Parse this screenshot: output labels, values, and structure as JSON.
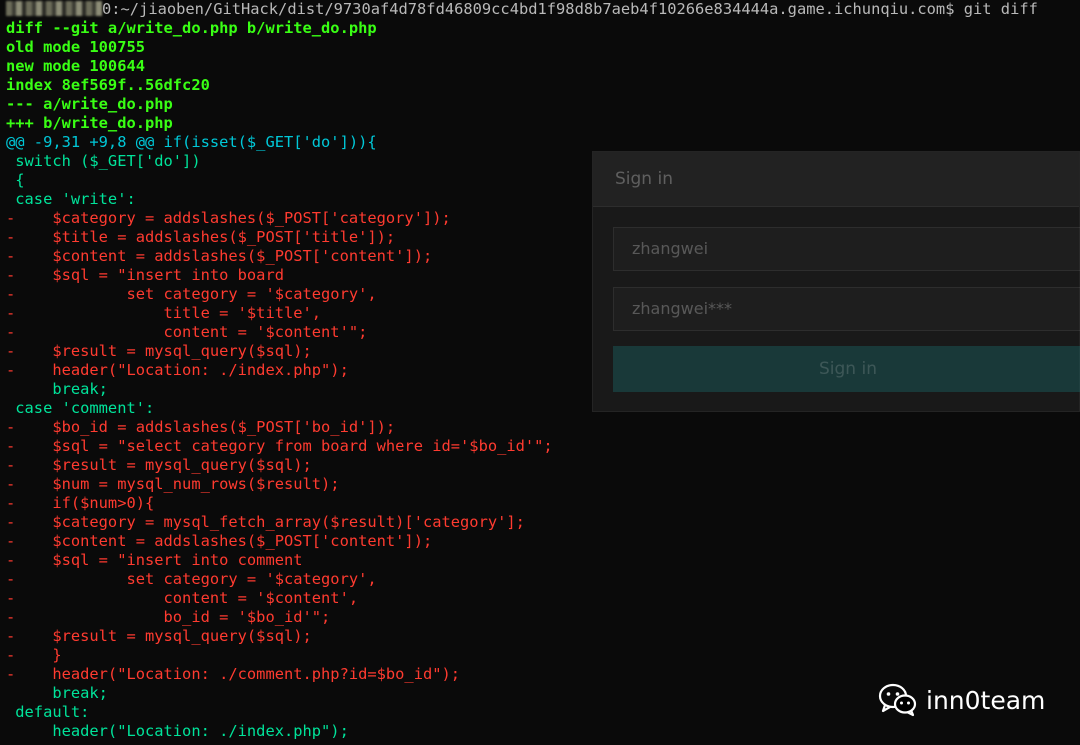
{
  "terminal": {
    "prompt_user": "0:~/jiaoben/GitHack/dist/9730af4d78fd46809cc4bd1f98d8b7aeb4f10266e834444a.game.ichunqiu.com$ git diff",
    "lines": [
      {
        "type": "meta",
        "text": "diff --git a/write_do.php b/write_do.php"
      },
      {
        "type": "meta",
        "text": "old mode 100755"
      },
      {
        "type": "meta",
        "text": "new mode 100644"
      },
      {
        "type": "meta",
        "text": "index 8ef569f..56dfc20"
      },
      {
        "type": "meta",
        "text": "--- a/write_do.php"
      },
      {
        "type": "meta",
        "text": "+++ b/write_do.php"
      },
      {
        "type": "hunk",
        "text": "@@ -9,31 +9,8 @@ if(isset($_GET['do'])){"
      },
      {
        "type": "ctx",
        "text": " switch ($_GET['do'])"
      },
      {
        "type": "ctx",
        "text": " {"
      },
      {
        "type": "ctx",
        "text": " case 'write':"
      },
      {
        "type": "del",
        "text": "-    $category = addslashes($_POST['category']);"
      },
      {
        "type": "del",
        "text": "-    $title = addslashes($_POST['title']);"
      },
      {
        "type": "del",
        "text": "-    $content = addslashes($_POST['content']);"
      },
      {
        "type": "del",
        "text": "-    $sql = \"insert into board"
      },
      {
        "type": "del",
        "text": "-            set category = '$category',"
      },
      {
        "type": "del",
        "text": "-                title = '$title',"
      },
      {
        "type": "del",
        "text": "-                content = '$content'\";"
      },
      {
        "type": "del",
        "text": "-    $result = mysql_query($sql);"
      },
      {
        "type": "del",
        "text": "-    header(\"Location: ./index.php\");"
      },
      {
        "type": "ctx",
        "text": "     break;"
      },
      {
        "type": "ctx",
        "text": " case 'comment':"
      },
      {
        "type": "del",
        "text": "-    $bo_id = addslashes($_POST['bo_id']);"
      },
      {
        "type": "del",
        "text": "-    $sql = \"select category from board where id='$bo_id'\";"
      },
      {
        "type": "del",
        "text": "-    $result = mysql_query($sql);"
      },
      {
        "type": "del",
        "text": "-    $num = mysql_num_rows($result);"
      },
      {
        "type": "del",
        "text": "-    if($num>0){"
      },
      {
        "type": "del",
        "text": "-    $category = mysql_fetch_array($result)['category'];"
      },
      {
        "type": "del",
        "text": "-    $content = addslashes($_POST['content']);"
      },
      {
        "type": "del",
        "text": "-    $sql = \"insert into comment"
      },
      {
        "type": "del",
        "text": "-            set category = '$category',"
      },
      {
        "type": "del",
        "text": "-                content = '$content',"
      },
      {
        "type": "del",
        "text": "-                bo_id = '$bo_id'\";"
      },
      {
        "type": "del",
        "text": "-    $result = mysql_query($sql);"
      },
      {
        "type": "del",
        "text": "-    }"
      },
      {
        "type": "del",
        "text": "-    header(\"Location: ./comment.php?id=$bo_id\");"
      },
      {
        "type": "ctx",
        "text": "     break;"
      },
      {
        "type": "ctx",
        "text": " default:"
      },
      {
        "type": "ctx",
        "text": "     header(\"Location: ./index.php\");"
      }
    ]
  },
  "signin_overlay": {
    "title": "Sign in",
    "username_value": "zhangwei",
    "password_value": "zhangwei***",
    "button_label": "Sign in"
  },
  "watermark": {
    "brand": "inn0team",
    "icon": "wechat-icon"
  },
  "colors": {
    "meta": "#39ff14",
    "hunk": "#00c8d8",
    "context": "#00e39a",
    "deletion": "#ff3b30"
  }
}
